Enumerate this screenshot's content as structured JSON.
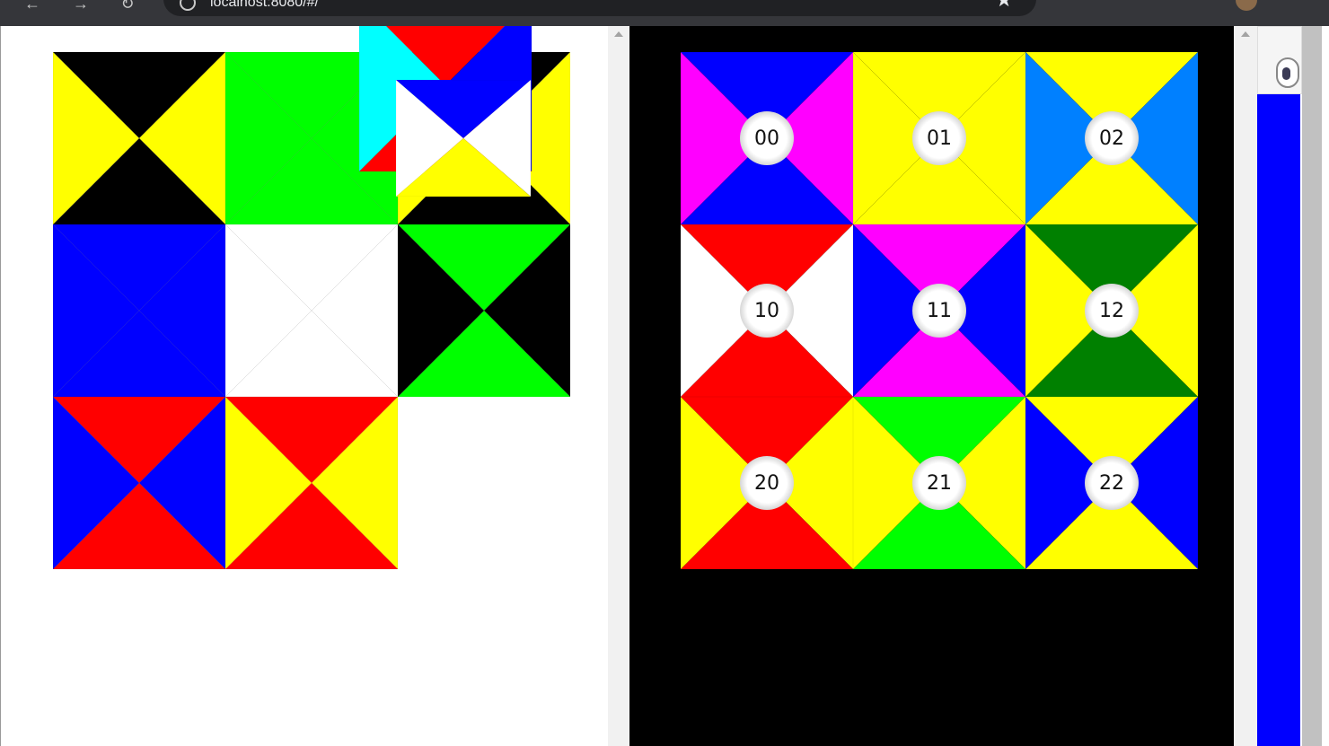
{
  "browser": {
    "url": "localhost:8080/#/",
    "nav_icons": [
      "back-icon",
      "forward-icon",
      "reload-icon"
    ]
  },
  "board_left": {
    "tiles": [
      {
        "cell": "00",
        "top": "#000000",
        "right": "#ffff00",
        "bottom": "#000000",
        "left": "#ffff00"
      },
      {
        "cell": "01",
        "top": "#00ff00",
        "right": "#00ff00",
        "bottom": "#00ff00",
        "left": "#00ff00"
      },
      {
        "cell": "02",
        "top": "#000000",
        "right": "#ffff00",
        "bottom": "#000000",
        "left": "#ffff00"
      },
      {
        "cell": "10",
        "top": "#0000ff",
        "right": "#0000ff",
        "bottom": "#0000ff",
        "left": "#0000ff"
      },
      {
        "cell": "11",
        "top": "#ffffff",
        "right": "#ffffff",
        "bottom": "#ffffff",
        "left": "#ffffff"
      },
      {
        "cell": "12",
        "top": "#00ff00",
        "right": "#000000",
        "bottom": "#00ff00",
        "left": "#000000"
      },
      {
        "cell": "20",
        "top": "#ff0000",
        "right": "#0000ff",
        "bottom": "#ff0000",
        "left": "#0000ff"
      },
      {
        "cell": "21",
        "top": "#ff0000",
        "right": "#ffff00",
        "bottom": "#ff0000",
        "left": "#ffff00"
      }
    ],
    "dragged_tiles": [
      {
        "top": "#ff0000",
        "right": "#0000ff",
        "bottom": "#ff0000",
        "left": "#00ffff"
      },
      {
        "top": "#0000ff",
        "right": "#ffffff",
        "bottom": "#ffff00",
        "left": "#ffffff"
      }
    ]
  },
  "board_right": {
    "tiles": [
      {
        "label": "00",
        "top": "#0000ff",
        "right": "#ff00ff",
        "bottom": "#0000ff",
        "left": "#ff00ff"
      },
      {
        "label": "01",
        "top": "#ffff00",
        "right": "#ffff00",
        "bottom": "#ffff00",
        "left": "#ffff00"
      },
      {
        "label": "02",
        "top": "#ffff00",
        "right": "#0080ff",
        "bottom": "#ffff00",
        "left": "#0080ff"
      },
      {
        "label": "10",
        "top": "#ff0000",
        "right": "#ffffff",
        "bottom": "#ff0000",
        "left": "#ffffff"
      },
      {
        "label": "11",
        "top": "#ff00ff",
        "right": "#0000ff",
        "bottom": "#ff00ff",
        "left": "#0000ff"
      },
      {
        "label": "12",
        "top": "#008000",
        "right": "#ffff00",
        "bottom": "#008000",
        "left": "#ffff00"
      },
      {
        "label": "20",
        "top": "#ff0000",
        "right": "#ffff00",
        "bottom": "#ff0000",
        "left": "#ffff00"
      },
      {
        "label": "21",
        "top": "#00ff00",
        "right": "#ffff00",
        "bottom": "#00ff00",
        "left": "#ffff00"
      },
      {
        "label": "22",
        "top": "#ffff00",
        "right": "#0000ff",
        "bottom": "#ffff00",
        "left": "#0000ff"
      }
    ]
  },
  "side_panel": {
    "icon": "extension-icon",
    "bar_color": "#0000ff"
  }
}
